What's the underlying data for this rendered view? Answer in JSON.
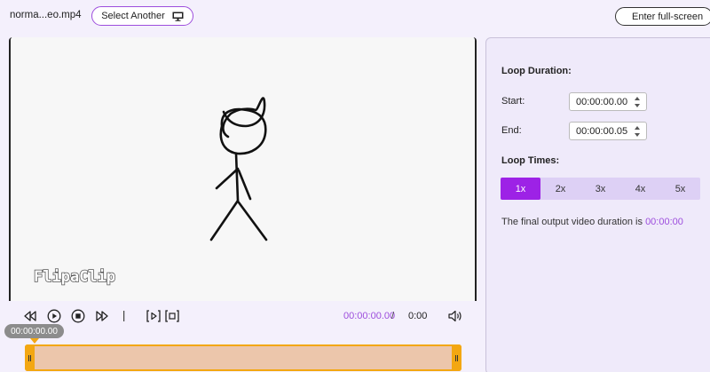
{
  "header": {
    "filename": "norma...eo.mp4",
    "select_another_label": "Select Another",
    "fullscreen_label": "Enter full-screen"
  },
  "player": {
    "watermark": "FlipaClip",
    "current_time": "00:00:00.00",
    "separator": "/",
    "total_time": "0:00"
  },
  "timeline": {
    "tooltip": "00:00:00.00"
  },
  "settings": {
    "loop_duration_title": "Loop Duration:",
    "start_label": "Start:",
    "start_value": "00:00:00.00",
    "end_label": "End:",
    "end_value": "00:00:00.05",
    "loop_times_title": "Loop Times:",
    "loop_options": [
      "1x",
      "2x",
      "3x",
      "4x",
      "5x"
    ],
    "selected_loop": "1x",
    "final_duration_text": "The final output video duration is",
    "final_duration_value": "00:00:00"
  },
  "colors": {
    "accent": "#9d4edd",
    "active_loop": "#9d22e6",
    "timeline_fill": "#ecc6ab",
    "timeline_border": "#f3a712"
  }
}
